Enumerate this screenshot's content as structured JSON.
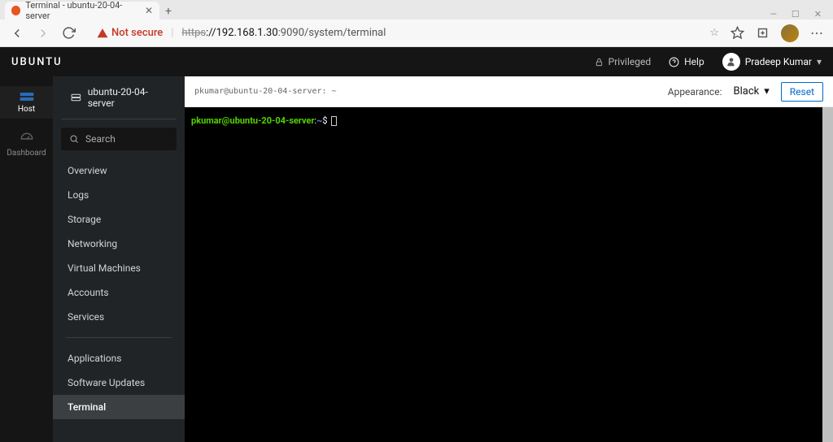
{
  "browser": {
    "tab_title": "Terminal - ubuntu-20-04-server",
    "security_label": "Not secure",
    "url_https": "https",
    "url_host": "://192.168.1.30",
    "url_rest": ":9090/system/terminal"
  },
  "header": {
    "brand": "UBUNTU",
    "privileged": "Privileged",
    "help": "Help",
    "user": "Pradeep Kumar"
  },
  "leftbar": {
    "host": "Host",
    "dashboard": "Dashboard"
  },
  "sidebar": {
    "hostname": "ubuntu-20-04-server",
    "search_placeholder": "Search",
    "items": [
      {
        "label": "Overview"
      },
      {
        "label": "Logs"
      },
      {
        "label": "Storage"
      },
      {
        "label": "Networking"
      },
      {
        "label": "Virtual Machines"
      },
      {
        "label": "Accounts"
      },
      {
        "label": "Services"
      }
    ],
    "items2": [
      {
        "label": "Applications"
      },
      {
        "label": "Software Updates"
      },
      {
        "label": "Terminal"
      }
    ]
  },
  "content": {
    "hint": "pkumar@ubuntu-20-04-server: ~",
    "appearance_label": "Appearance:",
    "appearance_value": "Black",
    "reset": "Reset"
  },
  "terminal": {
    "prompt_user": "pkumar@ubuntu-20-04-server",
    "prompt_sep": ":",
    "prompt_path": "~",
    "prompt_end": "$"
  }
}
